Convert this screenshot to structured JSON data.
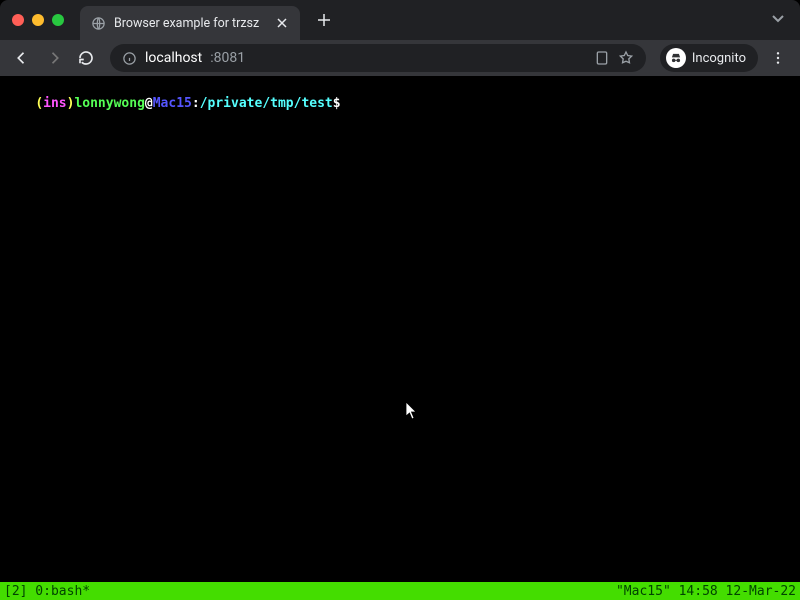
{
  "tab": {
    "title": "Browser example for trzsz"
  },
  "omnibox": {
    "host": "localhost",
    "port": ":8081"
  },
  "incognito": {
    "label": "Incognito"
  },
  "terminal": {
    "prompt": {
      "paren_open": "(",
      "mode": "ins",
      "paren_close": ")",
      "user": "lonnywong",
      "at": "@",
      "host": "Mac15",
      "colon": ":",
      "cwd": "/private/tmp/test",
      "dollar": "$"
    }
  },
  "status": {
    "left": "[2] 0:bash*",
    "right": "\"Mac15\" 14:58 12-Mar-22"
  }
}
